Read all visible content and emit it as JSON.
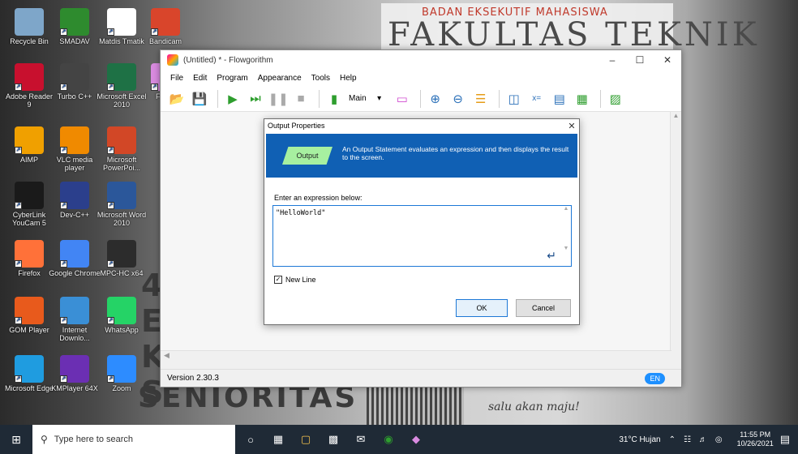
{
  "wallpaper": {
    "banner_top": "BADAN EKSEKUTIF MAHASISWA",
    "banner_main": "FAKULTAS TEKNIK",
    "left_text": "E K S",
    "bottom_big": "SENIORITAS",
    "bottom_script": "salu akan maju!"
  },
  "desktop_icons": [
    {
      "label": "Recycle Bin",
      "icon": "recycle-bin-icon",
      "color": "#7ea6c9"
    },
    {
      "label": "SMADAV",
      "icon": "smadav-icon",
      "color": "#2e8b2e"
    },
    {
      "label": "Matdis Tmatik",
      "icon": "document-icon",
      "color": "#ffffff"
    },
    {
      "label": "Bandicam",
      "icon": "bandicam-icon",
      "color": "#d9452b"
    },
    {
      "label": "Adobe Reader 9",
      "icon": "adobe-reader-icon",
      "color": "#c8102e"
    },
    {
      "label": "Turbo C++",
      "icon": "turbo-cpp-icon",
      "color": "#444444"
    },
    {
      "label": "Microsoft Excel 2010",
      "icon": "excel-icon",
      "color": "#1e7145"
    },
    {
      "label": "Flowg",
      "icon": "flowgorithm-icon",
      "color": "#d98be0"
    },
    {
      "label": "AIMP",
      "icon": "aimp-icon",
      "color": "#f0a000"
    },
    {
      "label": "VLC media player",
      "icon": "vlc-icon",
      "color": "#f08a00"
    },
    {
      "label": "Microsoft PowerPoi...",
      "icon": "powerpoint-icon",
      "color": "#d24726"
    },
    {
      "label": "CyberLink YouCam 5",
      "icon": "youcam-icon",
      "color": "#1a1a1a"
    },
    {
      "label": "Dev-C++",
      "icon": "devcpp-icon",
      "color": "#2b3f8c"
    },
    {
      "label": "Microsoft Word 2010",
      "icon": "word-icon",
      "color": "#2b579a"
    },
    {
      "label": "Firefox",
      "icon": "firefox-icon",
      "color": "#ff7139"
    },
    {
      "label": "Google Chrome",
      "icon": "chrome-icon",
      "color": "#4285f4"
    },
    {
      "label": "MPC-HC x64",
      "icon": "mpc-hc-icon",
      "color": "#2c2c2c"
    },
    {
      "label": "GOM Player",
      "icon": "gom-player-icon",
      "color": "#e85a1c"
    },
    {
      "label": "Internet Downlo...",
      "icon": "idm-icon",
      "color": "#3a8fd6"
    },
    {
      "label": "WhatsApp",
      "icon": "whatsapp-icon",
      "color": "#25d366"
    },
    {
      "label": "Microsoft Edge",
      "icon": "edge-icon",
      "color": "#1f9ce0"
    },
    {
      "label": "KMPlayer 64X",
      "icon": "kmplayer-icon",
      "color": "#6b2fb3"
    },
    {
      "label": "Zoom",
      "icon": "zoom-icon",
      "color": "#2d8cff"
    }
  ],
  "app": {
    "title": "(Untitled) * - Flowgorithm",
    "menu": [
      "File",
      "Edit",
      "Program",
      "Appearance",
      "Tools",
      "Help"
    ],
    "toolbar_mode": "Main",
    "version": "Version 2.30.3",
    "language_badge": "EN"
  },
  "dialog": {
    "title": "Output Properties",
    "shape_label": "Output",
    "description": "An Output Statement evaluates an expression and then displays the result to the screen.",
    "prompt": "Enter an expression below:",
    "expression": "\"HelloWorld\"",
    "new_line_label": "New Line",
    "new_line_checked": true,
    "ok_label": "OK",
    "cancel_label": "Cancel"
  },
  "taskbar": {
    "search_placeholder": "Type here to search",
    "weather": "31°C  Hujan",
    "time": "11:55 PM",
    "date": "10/26/2021"
  }
}
